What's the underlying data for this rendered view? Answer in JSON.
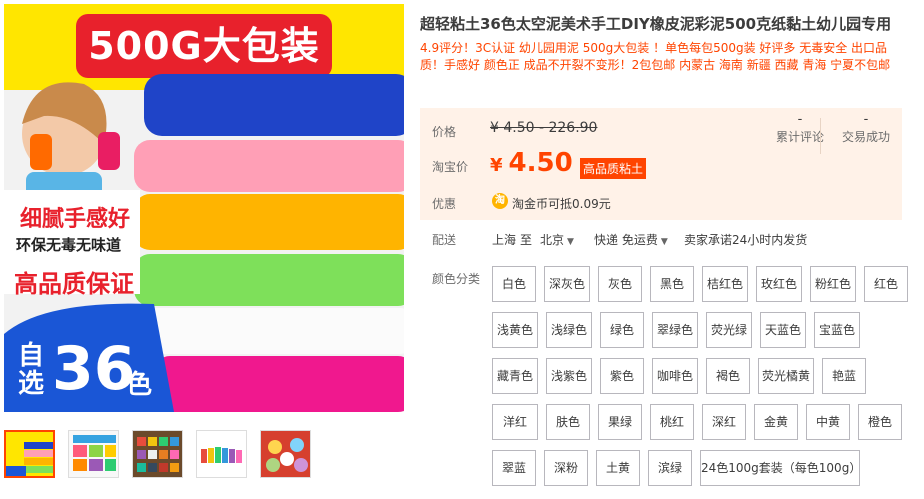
{
  "product": {
    "title": "超轻粘土36色太空泥美术手工DIY橡皮泥彩泥500克纸黏土幼儿园专用",
    "subtitle": "4.9评分！3C认证 幼儿园用泥 500g大包装 ！单色每包500g装 好评多 无毒安全 出口品质！手感好 颜色正 成品不开裂不变形！2包包邮 内蒙古 海南 新疆 西藏 青海 宁夏不包邮"
  },
  "image": {
    "banner": "500G大包装",
    "feature1": "细腻手感好",
    "feature2": "环保无毒无味道",
    "feature3": "高品质保证",
    "badge_pre": "自选",
    "badge_num": "36",
    "badge_post": "色",
    "thumbnails": [
      "thumb-1",
      "thumb-2",
      "thumb-3",
      "thumb-4",
      "thumb-5"
    ]
  },
  "price": {
    "price_label": "价格",
    "original": "¥ 4.50 - 226.90",
    "taobao_label": "淘宝价",
    "yen": "¥",
    "current": "4.50",
    "tag": "高品质粘土",
    "reviews_value": "-",
    "reviews_label": "累计评论",
    "sales_value": "-",
    "sales_label": "交易成功"
  },
  "discount": {
    "label": "优惠",
    "coin_icon": "淘",
    "text": "淘金币可抵0.09元"
  },
  "shipping": {
    "label": "配送",
    "from": "上海",
    "to_word": "至",
    "destination": "北京",
    "method": "快递 免运费",
    "promise": "卖家承诺24小时内发货"
  },
  "colors": {
    "label": "颜色分类",
    "options": [
      "白色",
      "深灰色",
      "灰色",
      "黑色",
      "桔红色",
      "玫红色",
      "粉红色",
      "红色",
      "浅黄色",
      "浅绿色",
      "绿色",
      "翠绿色",
      "荧光绿",
      "天蓝色",
      "宝蓝色",
      "藏青色",
      "浅紫色",
      "紫色",
      "咖啡色",
      "褐色",
      "荧光橘黄",
      "艳蓝",
      "洋红",
      "肤色",
      "果绿",
      "桃红",
      "深红",
      "金黄",
      "中黄",
      "橙色",
      "翠蓝",
      "深粉",
      "土黄",
      "滨绿",
      "24色100g套装（每色100g）"
    ]
  },
  "theme": {
    "accent": "#ff4400",
    "price_bg": "#fff2e8",
    "banner_red": "#e8212c",
    "badge_blue": "#1a56d6"
  }
}
